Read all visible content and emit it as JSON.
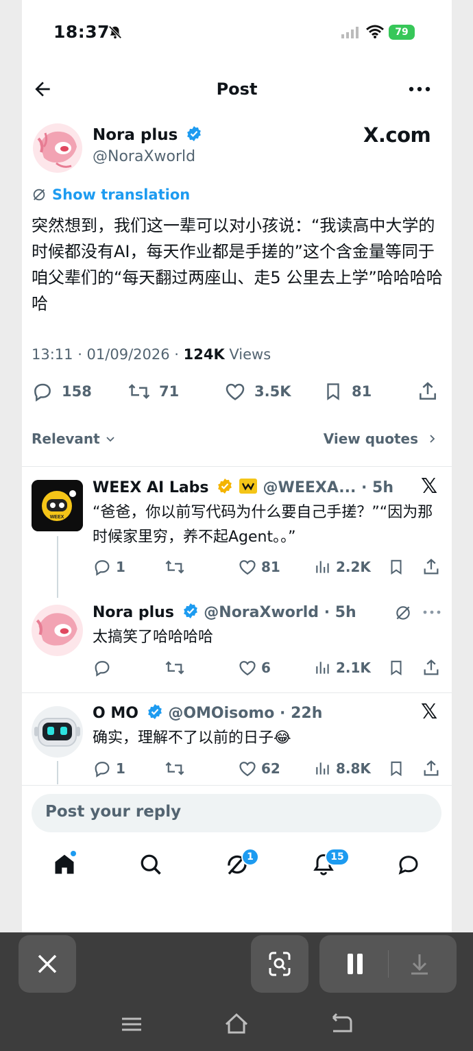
{
  "status_bar": {
    "time": "18:37",
    "battery": "79"
  },
  "header": {
    "title": "Post"
  },
  "tweet": {
    "author_name": "Nora plus",
    "author_handle": "@NoraXworld",
    "source_badge": "X.com",
    "show_translation": "Show translation",
    "body": "突然想到，我们这一辈可以对小孩说：“我读高中大学的时候都没有AI，每天作业都是手搓的”这个含金量等同于咱父辈们的“每天翻过两座山、走5 公里去上学”哈哈哈哈哈",
    "time": "13:11 · 01/09/2026 · ",
    "views_count": "124K",
    "views_label": " Views",
    "replies": "158",
    "reposts": "71",
    "likes": "3.5K",
    "bookmarks": "81"
  },
  "filter": {
    "sort_label": "Relevant",
    "view_quotes": "View quotes"
  },
  "replies": [
    {
      "name": "WEEX AI Labs",
      "handle": "@WEEXA... · 5h",
      "body": "“爸爸，你以前写代码为什么要自己手搓？”“因为那时候家里穷，养不起Agent。。”",
      "replies": "1",
      "reposts": "",
      "likes": "81",
      "views": "2.2K"
    },
    {
      "name": "Nora plus",
      "handle": "@NoraXworld · 5h",
      "body": "太搞笑了哈哈哈哈",
      "replies": "",
      "reposts": "",
      "likes": "6",
      "views": "2.1K"
    },
    {
      "name": "O MO",
      "handle": "@OMOisomo · 22h",
      "body": "确实，理解不了以前的日子😂",
      "replies": "1",
      "reposts": "",
      "likes": "62",
      "views": "8.8K"
    }
  ],
  "reply_box": {
    "placeholder": "Post your reply"
  },
  "tabbar": {
    "grok_badge": "1",
    "notifications_badge": "15"
  },
  "colors": {
    "accent": "#1d9bf0",
    "verified": "#1d9bf0",
    "gold_badge": "#f4b400",
    "battery": "#37c759"
  }
}
